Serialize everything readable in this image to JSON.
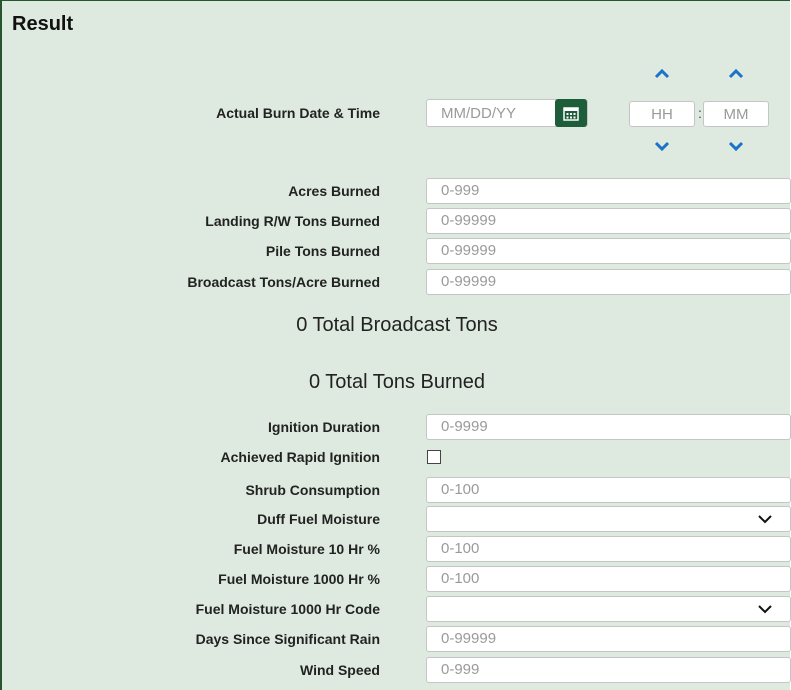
{
  "section_title": "Result",
  "burn_datetime": {
    "label": "Actual Burn Date & Time",
    "date_placeholder": "MM/DD/YY",
    "hour_placeholder": "HH",
    "minute_placeholder": "MM",
    "separator": ":"
  },
  "fields": {
    "acres_burned": {
      "label": "Acres Burned",
      "placeholder": "0-999"
    },
    "landing_tons": {
      "label": "Landing R/W Tons Burned",
      "placeholder": "0-99999"
    },
    "pile_tons": {
      "label": "Pile Tons Burned",
      "placeholder": "0-99999"
    },
    "broadcast_tons_acre": {
      "label": "Broadcast Tons/Acre Burned",
      "placeholder": "0-99999"
    },
    "ignition_duration": {
      "label": "Ignition Duration",
      "placeholder": "0-9999"
    },
    "rapid_ignition": {
      "label": "Achieved Rapid Ignition",
      "checked": false
    },
    "shrub_consumption": {
      "label": "Shrub Consumption",
      "placeholder": "0-100"
    },
    "duff_fuel_moisture": {
      "label": "Duff Fuel Moisture",
      "value": ""
    },
    "fuel_moisture_10": {
      "label": "Fuel Moisture 10 Hr %",
      "placeholder": "0-100"
    },
    "fuel_moisture_1000": {
      "label": "Fuel Moisture 1000 Hr %",
      "placeholder": "0-100"
    },
    "fuel_moisture_1000_code": {
      "label": "Fuel Moisture 1000 Hr Code",
      "value": ""
    },
    "days_since_rain": {
      "label": "Days Since Significant Rain",
      "placeholder": "0-99999"
    },
    "wind_speed": {
      "label": "Wind Speed",
      "placeholder": "0-999"
    }
  },
  "totals": {
    "broadcast": "0 Total Broadcast Tons",
    "burned": "0 Total Tons Burned"
  },
  "colors": {
    "panel_bg": "#deeadf",
    "accent": "#1a73c9",
    "button": "#1d5d3a"
  }
}
